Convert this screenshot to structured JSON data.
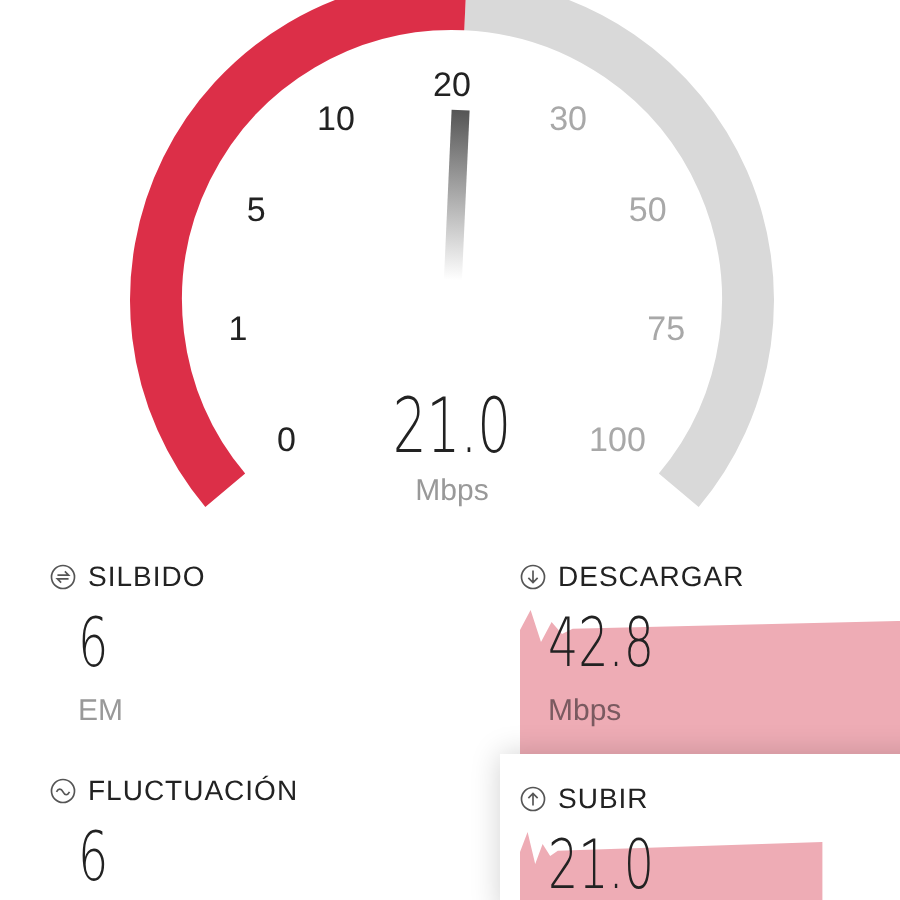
{
  "gauge": {
    "ticks": [
      {
        "label": "0",
        "reached": true
      },
      {
        "label": "1",
        "reached": true
      },
      {
        "label": "5",
        "reached": true
      },
      {
        "label": "10",
        "reached": true
      },
      {
        "label": "20",
        "reached": true
      },
      {
        "label": "30",
        "reached": false
      },
      {
        "label": "50",
        "reached": false
      },
      {
        "label": "75",
        "reached": false
      },
      {
        "label": "100",
        "reached": false
      }
    ],
    "value": "21.0",
    "unit": "Mbps"
  },
  "stats": [
    {
      "kind": "ping",
      "label": "SILBIDO",
      "value": "6",
      "unit": "EM",
      "active": false
    },
    {
      "kind": "download",
      "label": "DESCARGAR",
      "value": "42.8",
      "unit": "Mbps",
      "active": false
    },
    {
      "kind": "jitter",
      "label": "FLUCTUACIÓN",
      "value": "6",
      "active": false
    },
    {
      "kind": "upload",
      "label": "SUBIR",
      "value": "21.0",
      "active": true
    }
  ]
}
